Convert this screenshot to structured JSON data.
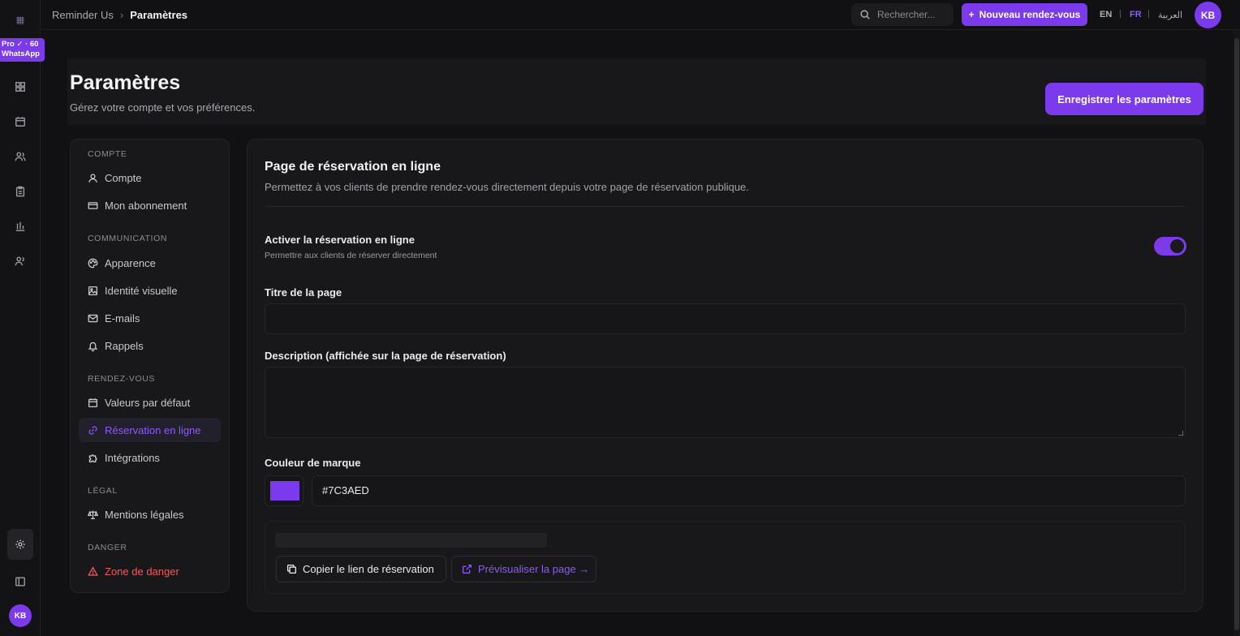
{
  "colors": {
    "accent": "#7c3aed",
    "danger": "#ef5a5a",
    "background": "#111113",
    "panel": "#18181b"
  },
  "rail": {
    "badge_line1": "Pro ✓ · 60",
    "badge_line2": "WhatsApp",
    "avatar": "KB",
    "icons": [
      "dashboard-icon",
      "calendar-icon",
      "users-icon",
      "clipboard-icon",
      "chart-icon",
      "user-icon",
      "settings-icon",
      "sidebar-toggle-icon"
    ]
  },
  "topbar": {
    "breadcrumb_root": "Reminder Us",
    "breadcrumb_sep": "›",
    "breadcrumb_current": "Paramètres",
    "search_placeholder": "Rechercher...",
    "new_button": "Nouveau rendez-vous",
    "lang_en": "EN",
    "lang_fr": "FR",
    "lang_ar": "العربية",
    "lang_sep": "|",
    "avatar": "KB"
  },
  "header": {
    "title": "Paramètres",
    "subtitle": "Gérez votre compte et vos préférences.",
    "save_button": "Enregistrer les paramètres"
  },
  "nav": {
    "section_account": "COMPTE",
    "item_account": "Compte",
    "item_subscription": "Mon abonnement",
    "section_communication": "COMMUNICATION",
    "item_appearance": "Apparence",
    "item_branding": "Identité visuelle",
    "item_emails": "E-mails",
    "item_reminders": "Rappels",
    "section_appointments": "RENDEZ-VOUS",
    "item_defaults": "Valeurs par défaut",
    "item_online_booking": "Réservation en ligne",
    "item_integrations": "Intégrations",
    "section_legal": "LÉGAL",
    "item_legal": "Mentions légales",
    "section_danger": "DANGER",
    "item_danger": "Zone de danger"
  },
  "main": {
    "title": "Page de réservation en ligne",
    "subtitle": "Permettez à vos clients de prendre rendez-vous directement depuis votre page de réservation publique.",
    "toggle_label": "Activer la réservation en ligne",
    "toggle_help": "Permettre aux clients de réserver directement",
    "toggle_on": true,
    "page_title_label": "Titre de la page",
    "page_title_value": "",
    "description_label": "Description (affichée sur la page de réservation)",
    "description_value": "",
    "brand_color_label": "Couleur de marque",
    "brand_color_value": "#7C3AED",
    "copy_link_button": "Copier le lien de réservation",
    "preview_button": "Prévisualiser la page →"
  }
}
